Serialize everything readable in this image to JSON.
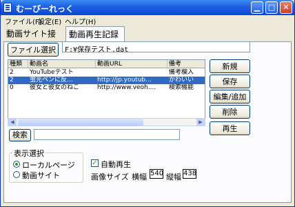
{
  "window": {
    "title": "むーびーれっく"
  },
  "menu": [
    "ファイル(F)",
    "設定(E)",
    "ヘルプ(H)"
  ],
  "tabs": [
    {
      "label": "動画サイト接続",
      "active": false
    },
    {
      "label": "動画再生記録",
      "active": true
    }
  ],
  "file_select": {
    "button_label": "ファイル選択",
    "path_value": "F:¥保存テスト.dat"
  },
  "grid": {
    "columns": [
      "種類",
      "動画名",
      "動画URL",
      "備考"
    ],
    "rows": [
      {
        "type": "2",
        "name": "YouTubeテスト",
        "url": "",
        "note": "備考欄入",
        "selected": false
      },
      {
        "type": "2",
        "name": "蛍光ペンに反...",
        "url": "http://jp.youtub...",
        "note": "かわいい",
        "selected": true
      },
      {
        "type": "0",
        "name": "彼女と彼女のねこ",
        "url": "http://www.veoh....",
        "note": "検索機能",
        "selected": false
      }
    ]
  },
  "side_buttons": [
    "新規",
    "保存",
    "編集/追加",
    "削除",
    "再生"
  ],
  "search": {
    "button_label": "検索",
    "value": ""
  },
  "display": {
    "group_label": "表示選択",
    "options": [
      {
        "label": "ローカルページ",
        "checked": true
      },
      {
        "label": "動画サイト",
        "checked": false
      }
    ]
  },
  "autoplay": {
    "label": "自動再生",
    "checked": true
  },
  "image_size": {
    "label": "画像サイズ",
    "width_label": "横幅",
    "width_value": "540",
    "height_label": "縦幅",
    "height_value": "438"
  },
  "colors": {
    "titlebar": "#0a46d6",
    "selection": "#316ac5",
    "window_bg": "#ece9d8"
  }
}
